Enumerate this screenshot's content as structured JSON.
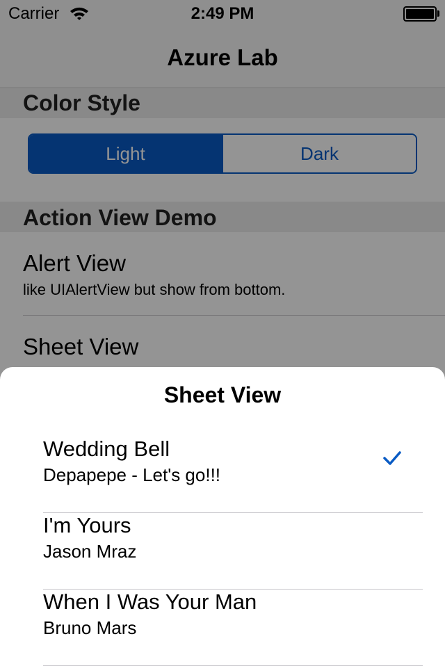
{
  "status_bar": {
    "carrier": "Carrier",
    "time": "2:49 PM"
  },
  "nav": {
    "title": "Azure Lab"
  },
  "sections": {
    "color_style": {
      "header": "Color Style",
      "segments": [
        "Light",
        "Dark"
      ],
      "selected": "Light"
    },
    "action_view": {
      "header": "Action View Demo",
      "rows": [
        {
          "title": "Alert View",
          "subtitle": "like UIAlertView but show from bottom."
        },
        {
          "title": "Sheet View",
          "subtitle": ""
        }
      ]
    }
  },
  "sheet": {
    "title": "Sheet View",
    "options": [
      {
        "title": "Wedding Bell",
        "subtitle": "Depapepe - Let's go!!!",
        "checked": true
      },
      {
        "title": "I'm Yours",
        "subtitle": "Jason Mraz",
        "checked": false
      },
      {
        "title": "When I Was Your Man",
        "subtitle": "Bruno Mars",
        "checked": false
      }
    ]
  },
  "colors": {
    "accent": "#0a5bc4",
    "overlay": "rgba(0,0,0,0.42)"
  },
  "icons": {
    "wifi": "wifi-icon",
    "battery": "battery-icon",
    "check": "checkmark-icon"
  }
}
